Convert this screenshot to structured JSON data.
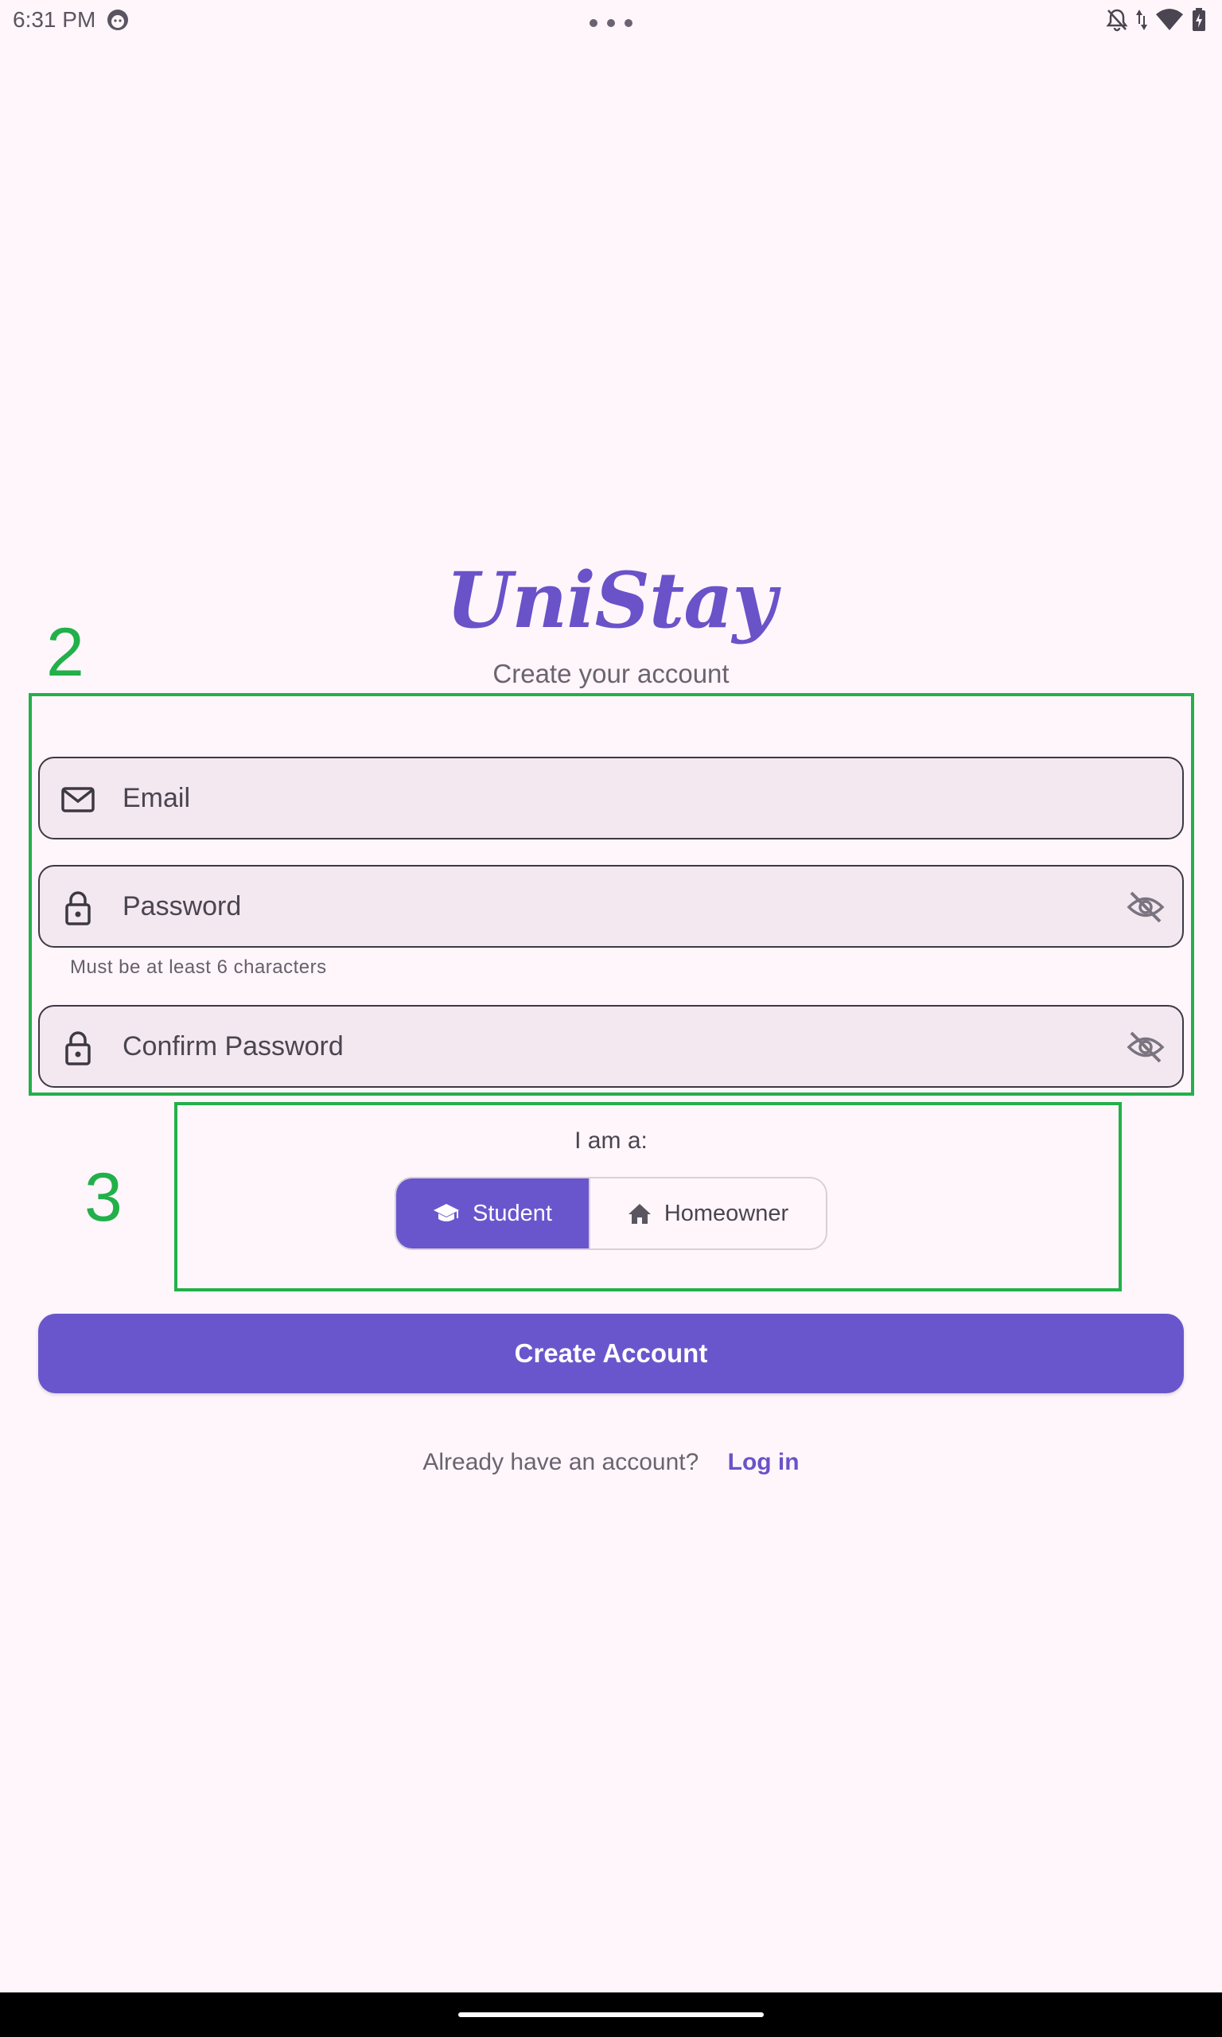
{
  "status_bar": {
    "time": "6:31 PM",
    "icons": [
      "face-icon",
      "more-dots-icon",
      "bell-off-icon",
      "data-arrows-icon",
      "wifi-icon",
      "battery-icon"
    ]
  },
  "header": {
    "logo": "UniStay",
    "subtitle": "Create your account"
  },
  "annotations": {
    "box_2_label": "2",
    "box_3_label": "3",
    "color": "#22b04a"
  },
  "form": {
    "email": {
      "placeholder": "Email",
      "value": "",
      "icon": "mail-icon"
    },
    "password": {
      "placeholder": "Password",
      "value": "",
      "icon": "lock-icon",
      "toggle_icon": "eye-off-icon",
      "helper": "Must be at least 6 characters"
    },
    "confirm_password": {
      "placeholder": "Confirm Password",
      "value": "",
      "icon": "lock-icon",
      "toggle_icon": "eye-off-icon"
    }
  },
  "role": {
    "label": "I am a:",
    "options": [
      {
        "label": "Student",
        "icon": "graduation-cap-icon",
        "selected": true
      },
      {
        "label": "Homeowner",
        "icon": "home-icon",
        "selected": false
      }
    ]
  },
  "actions": {
    "create_account": "Create Account",
    "login_prompt": "Already have an account?",
    "login_link": "Log in"
  },
  "colors": {
    "accent": "#6a56cc",
    "background": "#fff6fb",
    "field_background": "#f3e8ef"
  }
}
